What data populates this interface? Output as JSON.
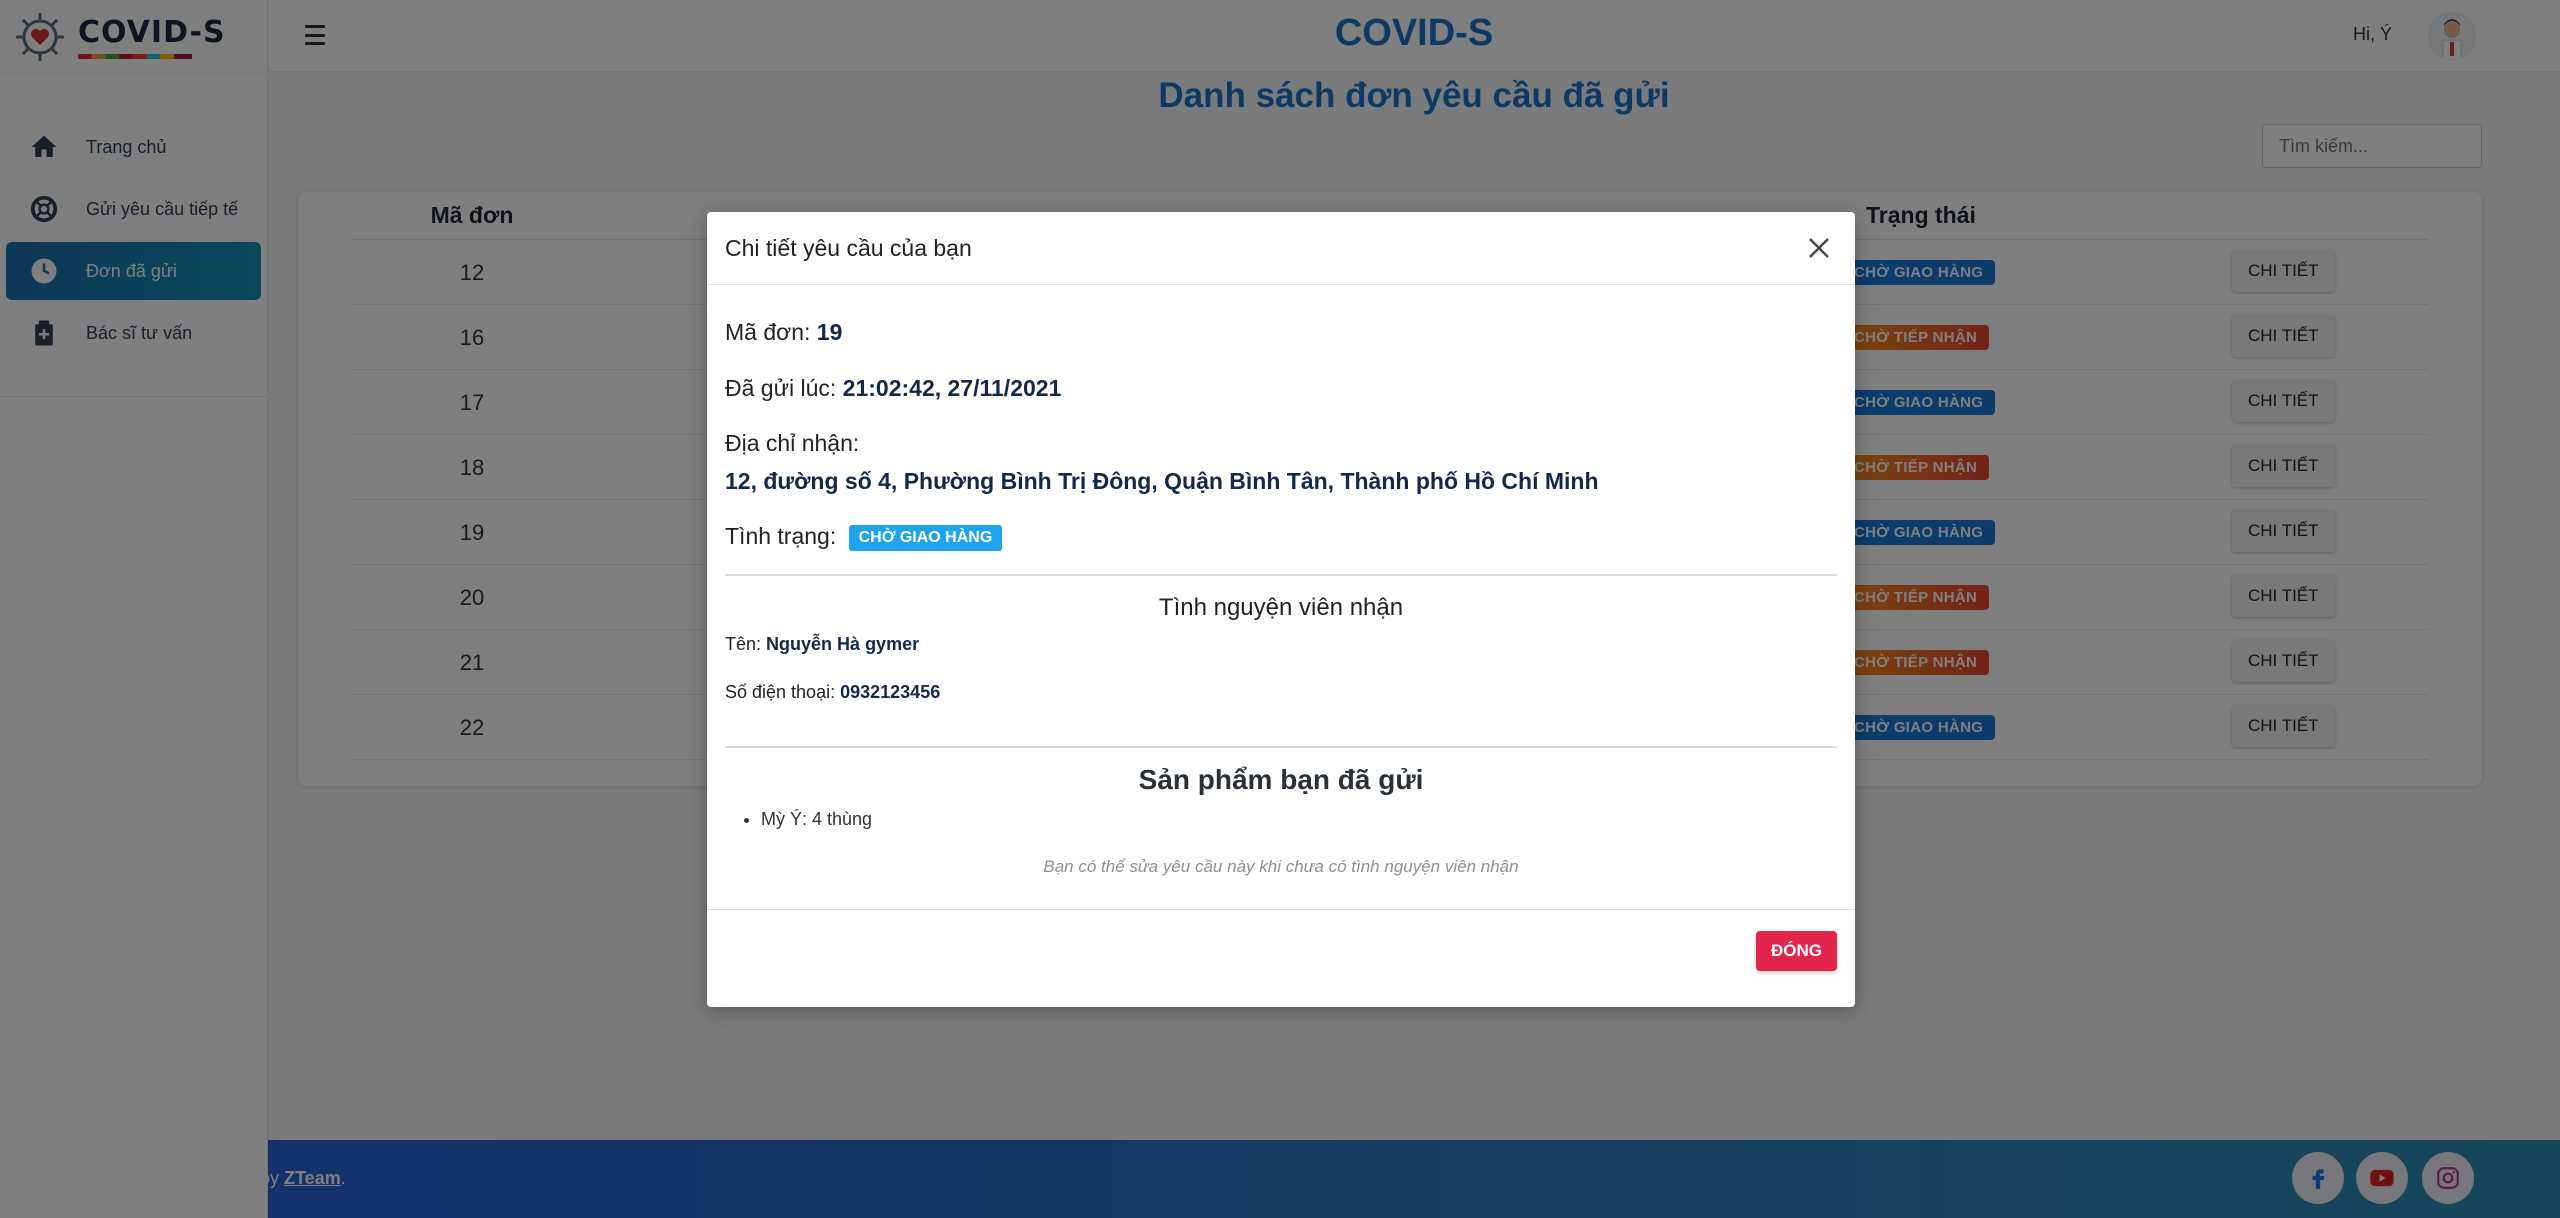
{
  "app": {
    "logo_text": "COVID-S",
    "title": "COVID-S",
    "greeting": "Hi, Ý"
  },
  "sidebar": {
    "items": [
      {
        "label": "Trang chủ",
        "icon": "home-icon"
      },
      {
        "label": "Gửi yêu cầu tiếp tế",
        "icon": "lifebuoy-icon"
      },
      {
        "label": "Đơn đã gửi",
        "icon": "clock-icon",
        "active": true
      },
      {
        "label": "Bác sĩ tư vấn",
        "icon": "medical-bag-icon"
      }
    ]
  },
  "page": {
    "title": "Danh sách đơn yêu cầu đã gửi",
    "search_placeholder": "Tìm kiếm...",
    "columns": {
      "id": "Mã đơn",
      "status": "Trạng thái"
    },
    "detail_label": "CHI TIẾT",
    "rows": [
      {
        "id": "12",
        "status": "CHỜ GIAO HÀNG"
      },
      {
        "id": "16",
        "status": "CHỜ TIẾP NHẬN"
      },
      {
        "id": "17",
        "status": "CHỜ GIAO HÀNG"
      },
      {
        "id": "18",
        "status": "CHỜ TIẾP NHẬN"
      },
      {
        "id": "19",
        "status": "CHỜ GIAO HÀNG"
      },
      {
        "id": "20",
        "status": "CHỜ TIẾP NHẬN"
      },
      {
        "id": "21",
        "status": "CHỜ TIẾP NHẬN"
      },
      {
        "id": "22",
        "status": "CHỜ GIAO HÀNG"
      }
    ]
  },
  "footer": {
    "by_text": "by",
    "team_link": "ZTeam",
    "period": "."
  },
  "modal": {
    "title": "Chi tiết yêu cầu của bạn",
    "order_label": "Mã đơn:",
    "order_value": "19",
    "sent_label": "Đã gửi lúc:",
    "sent_value": "21:02:42, 27/11/2021",
    "address_label": "Địa chỉ nhận:",
    "address_value": "12, đường số 4, Phường Bình Trị Đông, Quận Bình Tân, Thành phố Hồ Chí Minh",
    "status_label": "Tình trạng:",
    "status_value": "CHỜ GIAO HÀNG",
    "volunteer_heading": "Tình nguyện viên nhận",
    "name_label": "Tên:",
    "name_value": "Nguyễn Hà gymer",
    "phone_label": "Số điện thoại:",
    "phone_value": "0932123456",
    "products_heading": "Sản phẩm bạn đã gửi",
    "products": [
      "Mỳ Ý: 4 thùng"
    ],
    "note": "Bạn có thể sửa yêu cầu này khi chưa có tình nguyện viên nhận",
    "close_button": "ĐÓNG"
  },
  "colors": {
    "primary": "#1a74c8",
    "badge_delivery": "#1779d6",
    "badge_pending": "#f0662a",
    "close_button": "#e3244b"
  }
}
